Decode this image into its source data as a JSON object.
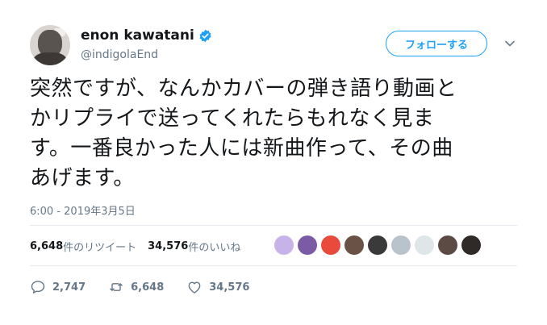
{
  "user": {
    "display_name": "enon kawatani",
    "handle": "@indigolaEnd"
  },
  "follow_button": {
    "label": "フォローする"
  },
  "tweet": {
    "lines": [
      "突然ですが、なんかカバーの弾き語り動画と",
      "かリプライで送ってくれたらもれなく見ま",
      "す。一番良かった人には新曲作って、その曲",
      "あげます。"
    ],
    "timestamp": "6:00 - 2019年3月5日"
  },
  "stats": {
    "retweets_count": "6,648",
    "retweets_label": "件のリツイート",
    "likes_count": "34,576",
    "likes_label": "件のいいね"
  },
  "likers": [
    {
      "icon": "liker-avatar-1",
      "color": "#c8b3e8"
    },
    {
      "icon": "liker-avatar-2",
      "color": "#7b5aa6"
    },
    {
      "icon": "liker-avatar-3",
      "color": "#e84a3b"
    },
    {
      "icon": "liker-avatar-4",
      "color": "#6b5246"
    },
    {
      "icon": "liker-avatar-5",
      "color": "#3a3a3a"
    },
    {
      "icon": "liker-avatar-6",
      "color": "#b9c3cc"
    },
    {
      "icon": "liker-avatar-7",
      "color": "#dfe6ea"
    },
    {
      "icon": "liker-avatar-8",
      "color": "#5c4b45"
    },
    {
      "icon": "liker-avatar-9",
      "color": "#2f2a28"
    }
  ],
  "actions": {
    "replies": "2,747",
    "retweets": "6,648",
    "likes": "34,576"
  },
  "colors": {
    "accent": "#1da1f2",
    "secondary_text": "#657786",
    "primary_text": "#14171a"
  }
}
